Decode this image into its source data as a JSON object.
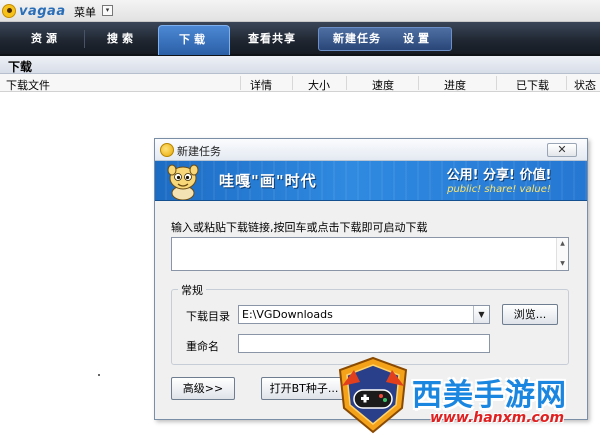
{
  "app": {
    "logo_text": "vagaa",
    "menu_label": "菜单",
    "menu_dropdown_glyph": "▾"
  },
  "tabs": [
    {
      "label": "资源"
    },
    {
      "label": "搜索"
    },
    {
      "label": "下载",
      "active": true
    },
    {
      "label": "查看共享"
    },
    {
      "label": "新建任务"
    },
    {
      "label": "设置"
    }
  ],
  "section": {
    "title": "下载"
  },
  "columns": [
    "下载文件",
    "详情",
    "大小",
    "速度",
    "进度",
    "已下载",
    "状态"
  ],
  "dialog": {
    "title": "新建任务",
    "close_glyph": "✕",
    "banner": {
      "slogan": "哇嘎\"画\"时代",
      "slogan_right": "公用! 分享! 价值!",
      "slogan_en": "public! share! value!"
    },
    "instruction": "输入或粘贴下载链接,按回车或点击下载即可启动下载",
    "url_value": "",
    "group_title": "常规",
    "dir_label": "下载目录",
    "dir_value": "E:\\VGDownloads",
    "browse_label": "浏览...",
    "rename_label": "重命名",
    "rename_value": "",
    "advanced_label": "高级>>",
    "open_bt_label": "打开BT种子..."
  },
  "watermark": {
    "text_cn": "西美手游网",
    "url": "www.hanxm.com"
  },
  "colors": {
    "tab_bar": "#1f2631",
    "tab_active": "#3a74c0",
    "banner": "#2f8ae0",
    "watermark_cn": "#1a86e0",
    "watermark_url": "#e02020"
  }
}
